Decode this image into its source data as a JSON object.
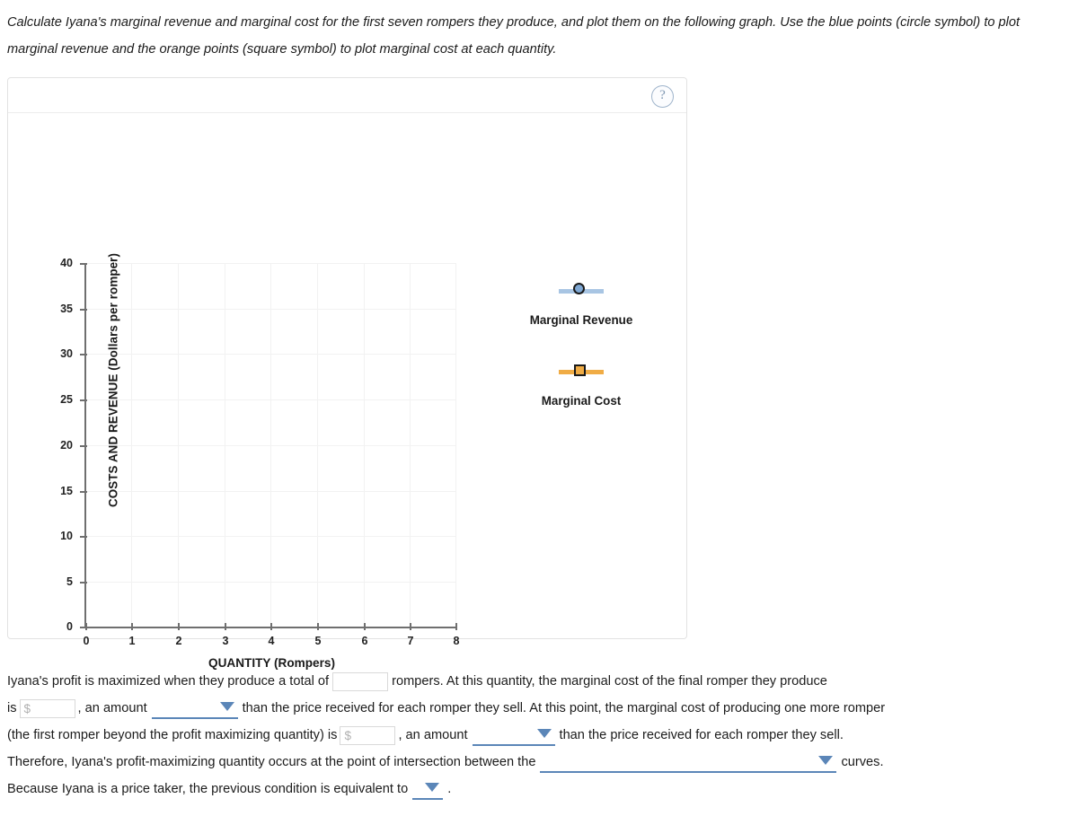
{
  "prompt": "Calculate Iyana's marginal revenue and marginal cost for the first seven rompers they produce, and plot them on the following graph. Use the blue points (circle symbol) to plot marginal revenue and the orange points (square symbol) to plot marginal cost at each quantity.",
  "panel": {
    "help_icon": "?"
  },
  "chart_data": {
    "type": "scatter",
    "title": "",
    "xlabel": "QUANTITY (Rompers)",
    "ylabel": "COSTS AND REVENUE (Dollars per romper)",
    "xlim": [
      0,
      8
    ],
    "ylim": [
      0,
      40
    ],
    "xticks": [
      "0",
      "1",
      "2",
      "3",
      "4",
      "5",
      "6",
      "7",
      "8"
    ],
    "yticks": [
      "0",
      "5",
      "10",
      "15",
      "20",
      "25",
      "30",
      "35",
      "40"
    ],
    "grid": true,
    "legend_position": "right",
    "series": [
      {
        "name": "Marginal Revenue",
        "symbol": "circle",
        "color": "#7fa8d4",
        "line_color": "#a8c5e3",
        "edge_color": "#1a1a1a",
        "x": [],
        "values": []
      },
      {
        "name": "Marginal Cost",
        "symbol": "square",
        "color": "#f0ac45",
        "line_color": "#f0ac45",
        "edge_color": "#1a1a1a",
        "x": [],
        "values": []
      }
    ]
  },
  "answers": {
    "line1a": "Iyana's profit is maximized when they produce a total of",
    "qty_value": "",
    "line1b": "rompers. At this quantity, the marginal cost of the final romper they produce",
    "line2a": "is",
    "mc_final_value": "",
    "mc_final_placeholder": "$",
    "line2b": ", an amount",
    "dd1_value": "",
    "line2c": "than the price received for each romper they sell. At this point, the marginal cost of producing one more romper",
    "line3a": "(the first romper beyond the profit maximizing quantity) is",
    "mc_next_value": "",
    "mc_next_placeholder": "$",
    "line3b": ", an amount",
    "dd2_value": "",
    "line3c": "than the price received for each romper they sell.",
    "line4a": "Therefore, Iyana's profit-maximizing quantity occurs at the point of intersection between the",
    "dd3_value": "",
    "line4b": "curves.",
    "line5a": "Because Iyana is a price taker, the previous condition is equivalent to",
    "dd4_value": "",
    "line5b": "."
  },
  "colors": {
    "accent_blue": "#5b86b8",
    "marker_blue": "#7fa8d4",
    "marker_orange": "#f0ac45",
    "axis_gray": "#6f6f6f",
    "grid_gray": "#f2f2f2"
  }
}
